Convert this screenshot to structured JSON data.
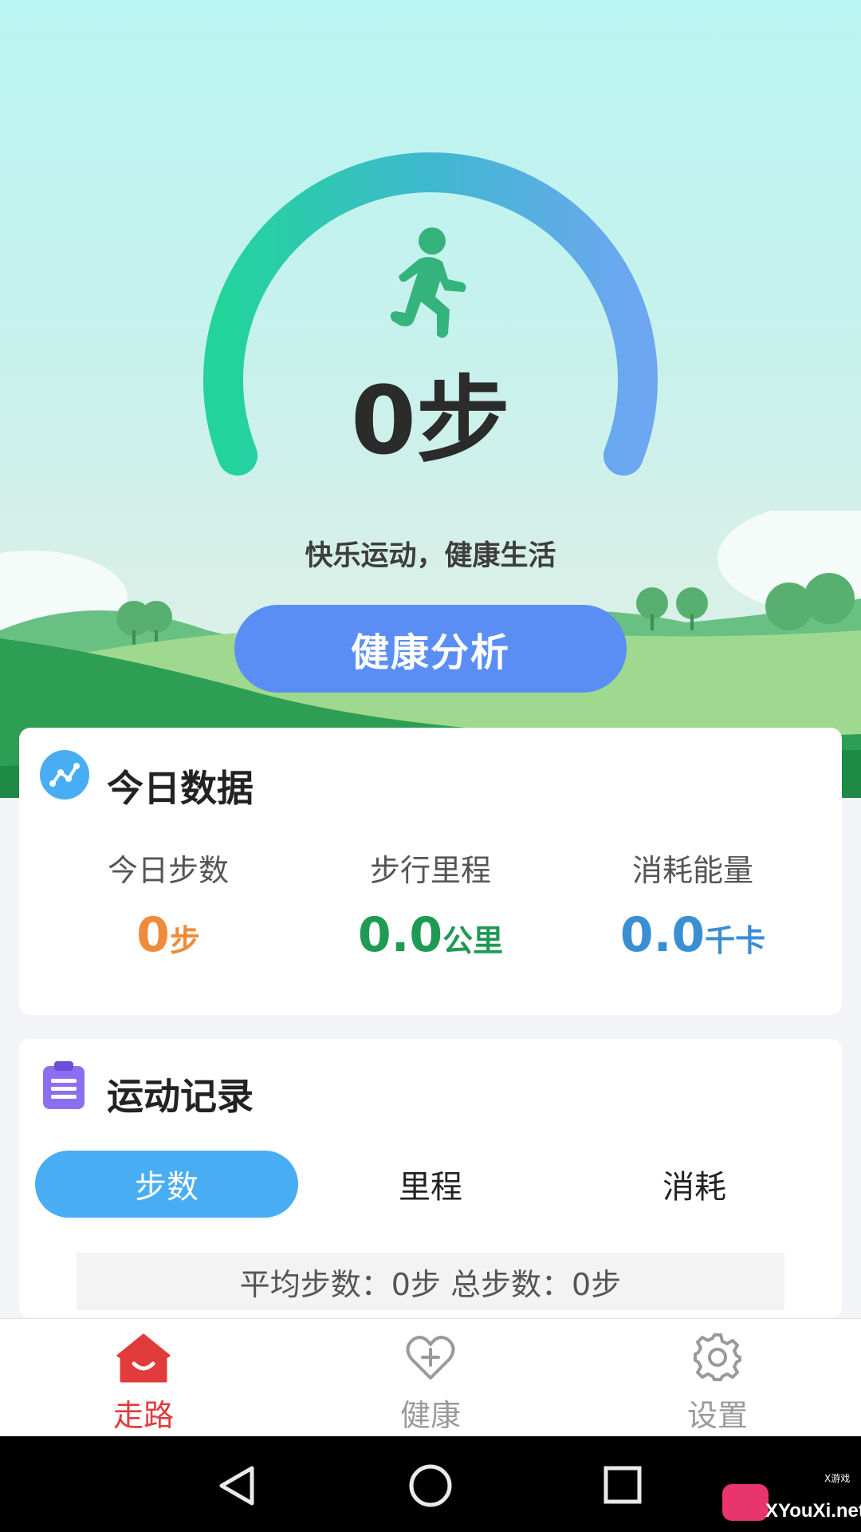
{
  "colors": {
    "accent_blue": "#5b8ef4",
    "steps_orange": "#f08b3a",
    "distance_green": "#1f9a55",
    "calories_blue": "#3a8ed4",
    "nav_active_red": "#e23b3b",
    "nav_inactive_gray": "#9a9a9a",
    "tab_active_blue": "#49adf3"
  },
  "hero": {
    "steps_value": "0步",
    "slogan": "快乐运动，健康生活",
    "analysis_button": "健康分析",
    "icon": "runner-icon"
  },
  "today": {
    "title": "今日数据",
    "icon": "trend-icon",
    "stats": [
      {
        "label": "今日步数",
        "value": "0",
        "unit": "步"
      },
      {
        "label": "步行里程",
        "value": "0.0",
        "unit": "公里"
      },
      {
        "label": "消耗能量",
        "value": "0.0",
        "unit": "千卡"
      }
    ]
  },
  "records": {
    "title": "运动记录",
    "icon": "clipboard-icon",
    "tabs": [
      "步数",
      "里程",
      "消耗"
    ],
    "active_tab": "步数",
    "summary": "平均步数：0步 总步数：0步"
  },
  "bottom_nav": [
    {
      "label": "走路",
      "icon": "home-icon",
      "active": true
    },
    {
      "label": "健康",
      "icon": "heart-plus-icon",
      "active": false
    },
    {
      "label": "设置",
      "icon": "gear-icon",
      "active": false
    }
  ],
  "system_nav": [
    "back-icon",
    "home-circle-icon",
    "recents-icon"
  ],
  "watermark": {
    "text": "XYouXi.net",
    "small": "X游戏"
  }
}
